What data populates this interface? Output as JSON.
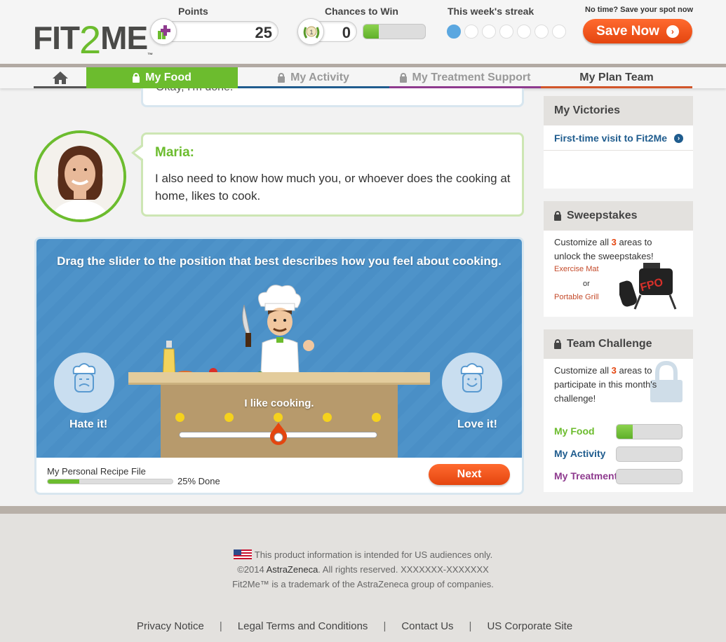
{
  "header": {
    "logo_left": "FIT",
    "logo_mid": "2",
    "logo_right": "ME",
    "logo_tm": "™",
    "points_label": "Points",
    "points_value": "25",
    "chances_label": "Chances to Win",
    "chances_value": "0",
    "chances_progress": 0.25,
    "streak_label": "This week's streak",
    "streak_days": [
      true,
      false,
      false,
      false,
      false,
      false,
      false
    ],
    "notime_text": "No time? Save your spot now",
    "save_label": "Save Now",
    "badge_number": "1"
  },
  "nav": {
    "items": [
      {
        "label": "",
        "name": "home"
      },
      {
        "label": "My Food",
        "name": "my-food",
        "locked": true,
        "active": true
      },
      {
        "label": "My Activity",
        "name": "my-activity",
        "locked": true
      },
      {
        "label": "My Treatment Support",
        "name": "my-treatment-support",
        "locked": true
      },
      {
        "label": "My Plan Team",
        "name": "my-plan-team",
        "locked": false
      }
    ]
  },
  "chat": {
    "previous_text": "Okay, I'm done.",
    "speaker": "Maria:",
    "message": "I also need to know how much you, or whoever does the cooking at home, likes to cook."
  },
  "activity": {
    "instruction": "Drag the slider to the position that best describes how you feel about cooking.",
    "left_label": "Hate it!",
    "right_label": "Love it!",
    "slider_value_label": "I like cooking.",
    "slider_level": 0.5,
    "recipe_label": "My Personal Recipe File",
    "recipe_progress": 0.25,
    "recipe_done": "25% Done",
    "next_label": "Next"
  },
  "sidebar": {
    "victories_title": "My Victories",
    "victory_item": "First-time visit to Fit2Me",
    "sweepstakes_title": "Sweepstakes",
    "sweep_text_pre": "Customize all ",
    "sweep_num": "3",
    "sweep_text_post": " areas to unlock the sweepstakes!",
    "prize_1": "Exercise Mat",
    "prize_or": "or",
    "prize_2": "Portable Grill",
    "fpo": "FPO",
    "team_title": "Team Challenge",
    "team_text_pre": "Customize all ",
    "team_num": "3",
    "team_text_post": " areas to participate in this month's challenge!",
    "challenge_rows": [
      {
        "label": "My Food",
        "color": "#6cbc2e",
        "progress": 0.25
      },
      {
        "label": "My Activity",
        "color": "#1f5c8e",
        "progress": 0
      },
      {
        "label": "My Treatment",
        "color": "#8e3a8e",
        "progress": 0
      }
    ]
  },
  "footer": {
    "line1": "This product information is intended for US audiences only.",
    "line2_pre": "©2014 ",
    "line2_brand": "AstraZeneca",
    "line2_post": ". All rights reserved. XXXXXXX-XXXXXXX",
    "line3": "Fit2Me™ is a trademark of the AstraZeneca group of companies.",
    "links": [
      "Privacy Notice",
      "Legal Terms and Conditions",
      "Contact Us",
      "US Corporate Site"
    ],
    "sep": "|"
  },
  "colors": {
    "brand_green": "#6cbc2e",
    "accent_orange": "#e4450f",
    "nav_blue": "#1f5c8e",
    "nav_purple": "#8e3a8e",
    "nav_orange": "#d1552a"
  }
}
